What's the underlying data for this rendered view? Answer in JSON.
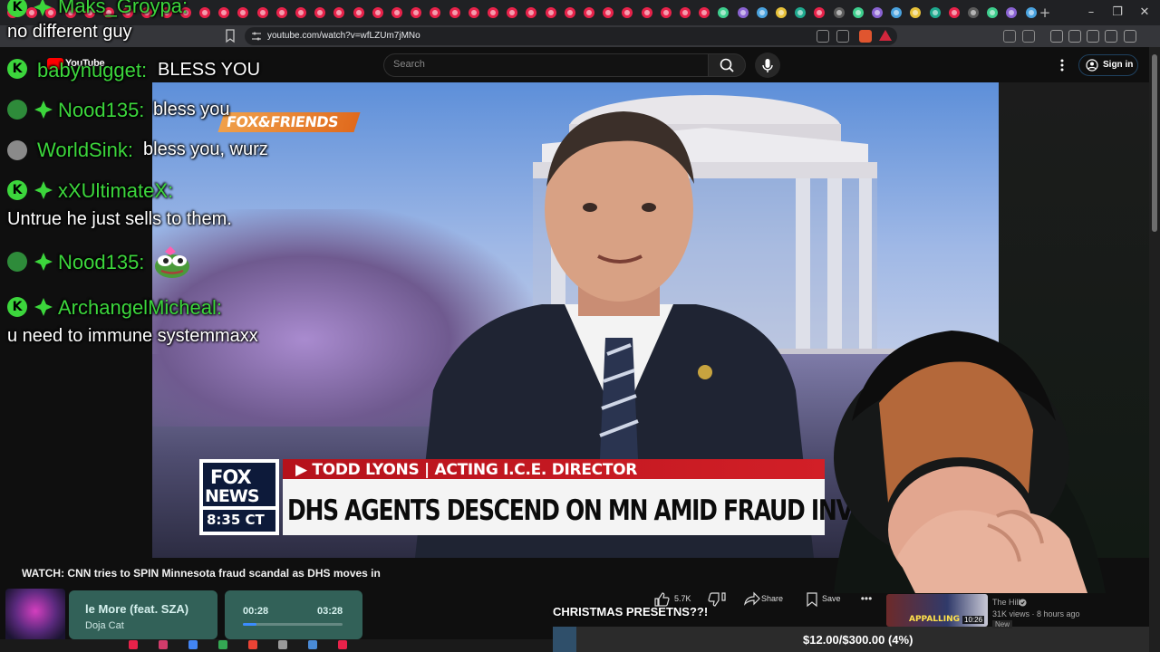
{
  "browser": {
    "url": "youtube.com/watch?v=wfLZUm7jMNo",
    "tab_colors": [
      "#e8224a",
      "#e8224a",
      "#e8224a",
      "#e8224a",
      "#e8224a",
      "#e8224a",
      "#e8224a",
      "#e8224a",
      "#e8224a",
      "#e8224a",
      "#e8224a",
      "#e8224a",
      "#e8224a",
      "#e8224a",
      "#e8224a",
      "#e8224a",
      "#e8224a",
      "#e8224a",
      "#e8224a",
      "#e8224a",
      "#e8224a",
      "#e8224a",
      "#e8224a",
      "#e8224a",
      "#e8224a",
      "#e8224a",
      "#e8224a",
      "#e8224a",
      "#e8224a",
      "#e8224a",
      "#e8224a",
      "#e8224a",
      "#e8224a",
      "#e8224a",
      "#e8224a",
      "#e8224a",
      "#e8224a",
      "#e8224a",
      "#e8224a",
      "#e8224a",
      "#e8224a",
      "#e8224a",
      "#e8224a",
      "#e8224a",
      "#e8224a",
      "#e8224a",
      "#e8224a",
      "#e8224a",
      "#e8224a",
      "#e8224a",
      "#e8224a",
      "#e8224a",
      "#e8224a",
      "#e8224a"
    ],
    "new_tab_icon": "+",
    "window_controls": [
      "–",
      "❐",
      "✕"
    ],
    "extension_icons": [
      "screen-icon",
      "share-icon",
      "brave-shield-icon",
      "warning-icon",
      "puzzle-icon",
      "window-icon",
      "music-icon",
      "sidebar-icon",
      "wallet-icon",
      "vpn-icon",
      "menu-icon"
    ]
  },
  "youtube": {
    "logo_text": "YouTube",
    "search_placeholder": "Search",
    "sign_in_label": "Sign in",
    "accent": "#ff0000"
  },
  "video": {
    "program_logo": "FOX&FRIENDS",
    "network_line1": "FOX",
    "network_line2": "NEWS",
    "time": "8:35 CT",
    "name_bar": "▶ TODD LYONS | ACTING I.C.E. DIRECTOR",
    "headline": "DHS AGENTS DESCEND ON MN AMID FRAUD INVESTIGATIO",
    "title": "WATCH: CNN tries to SPIN Minnesota fraud scandal as DHS moves in",
    "likes": "5.7K",
    "share_label": "Share",
    "save_label": "Save",
    "more_label": "•••"
  },
  "chat": [
    {
      "user": "Maks_Groypa:",
      "message": "no different guy"
    },
    {
      "user": "babynugget:",
      "message": "BLESS YOU"
    },
    {
      "user": "Nood135:",
      "message": "bless you"
    },
    {
      "user": "WorldSink:",
      "message": "bless you, wurz"
    },
    {
      "user": "xXUltimateX:",
      "message": "Untrue he just sells to them."
    },
    {
      "user": "Nood135:",
      "message": ""
    },
    {
      "user": "ArchangelMicheal:",
      "message": "u need to immune systemmaxx"
    }
  ],
  "chat_colors": {
    "username": "#3cd63c",
    "kick_badge": "#3cd63c",
    "sub_badge": "#3cd63c"
  },
  "music": {
    "title": "le More (feat. SZA)",
    "artist": "Doja Cat",
    "current": "00:28",
    "total": "03:28",
    "progress": 0.135
  },
  "overlay": {
    "message": "CHRISTMAS PRESETNS??!",
    "goal": "$12.00/$300.00 (4%)",
    "goal_progress": 0.04
  },
  "recommendation": {
    "thumb_text": "APPALLING",
    "duration": "10:26",
    "channel": "The Hill",
    "meta": "31K views · 8 hours ago",
    "badge": "New"
  }
}
